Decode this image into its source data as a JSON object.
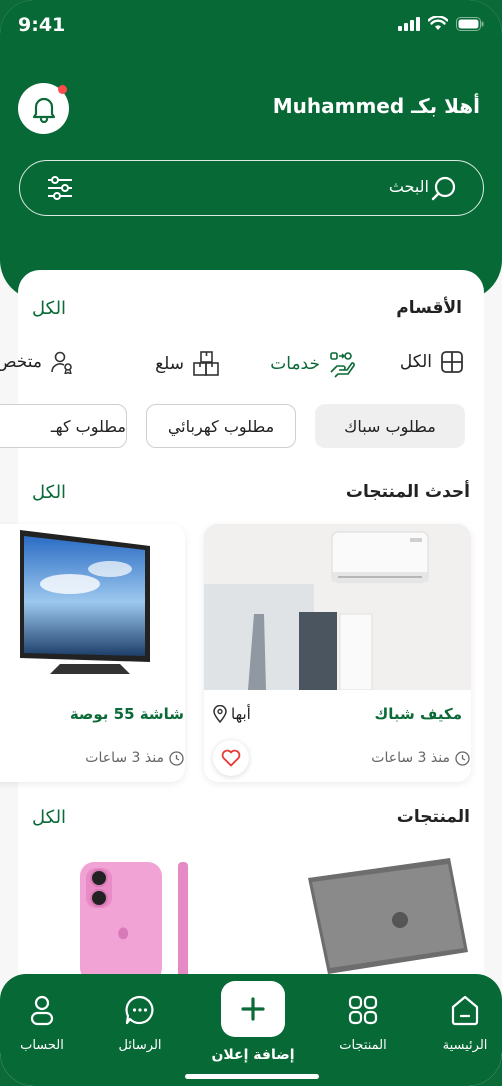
{
  "status_bar": {
    "time": "9:41"
  },
  "header": {
    "greeting": "أهلا بكـ Muhammed"
  },
  "search": {
    "placeholder": "البحث"
  },
  "categories": {
    "title": "الأقسام",
    "see_all": "الكل",
    "items": [
      {
        "label": "الكل",
        "icon": "grid-icon"
      },
      {
        "label": "خدمات",
        "icon": "services-icon",
        "active": true
      },
      {
        "label": "سلع",
        "icon": "boxes-icon"
      },
      {
        "label": "متخص",
        "icon": "specialist-icon"
      }
    ]
  },
  "chips": [
    {
      "label": "مطلوب سباك",
      "selected": true
    },
    {
      "label": "مطلوب كهربائي"
    },
    {
      "label": "مطلوب كهـ"
    }
  ],
  "latest_products": {
    "title": "أحدث المنتجات",
    "see_all": "الكل",
    "items": [
      {
        "name": "مكيف شباك",
        "location": "أبها",
        "time": "منذ 3 ساعات",
        "image": "air-conditioner"
      },
      {
        "name": "شاشة 55 بوصة",
        "time": "منذ 3 ساعات",
        "image": "television"
      }
    ]
  },
  "products": {
    "title": "المنتجات",
    "see_all": "الكل"
  },
  "nav": {
    "home": "الرئيسية",
    "products": "المنتجات",
    "add": "إضافة إعلان",
    "messages": "الرسائل",
    "account": "الحساب"
  },
  "colors": {
    "primary": "#076a36",
    "accent_red": "#e53935",
    "chip_bg": "#efefef"
  }
}
